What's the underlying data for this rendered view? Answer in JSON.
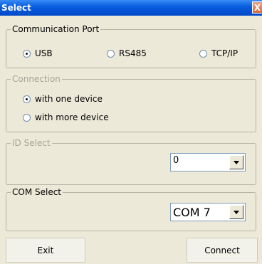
{
  "window": {
    "title": "Select",
    "close_glyph": "X"
  },
  "communication_port": {
    "legend": "Communication Port",
    "options": [
      {
        "label": "USB",
        "selected": true
      },
      {
        "label": "RS485",
        "selected": false
      },
      {
        "label": "TCP/IP",
        "selected": false
      }
    ]
  },
  "connection": {
    "legend": "Connection",
    "options": [
      {
        "label": "with one device",
        "selected": true
      },
      {
        "label": "with more device",
        "selected": false
      }
    ]
  },
  "id_select": {
    "legend": "ID Select",
    "value": "0"
  },
  "com_select": {
    "legend": "COM Select",
    "value": "COM 7"
  },
  "buttons": {
    "exit": "Exit",
    "connect": "Connect"
  }
}
